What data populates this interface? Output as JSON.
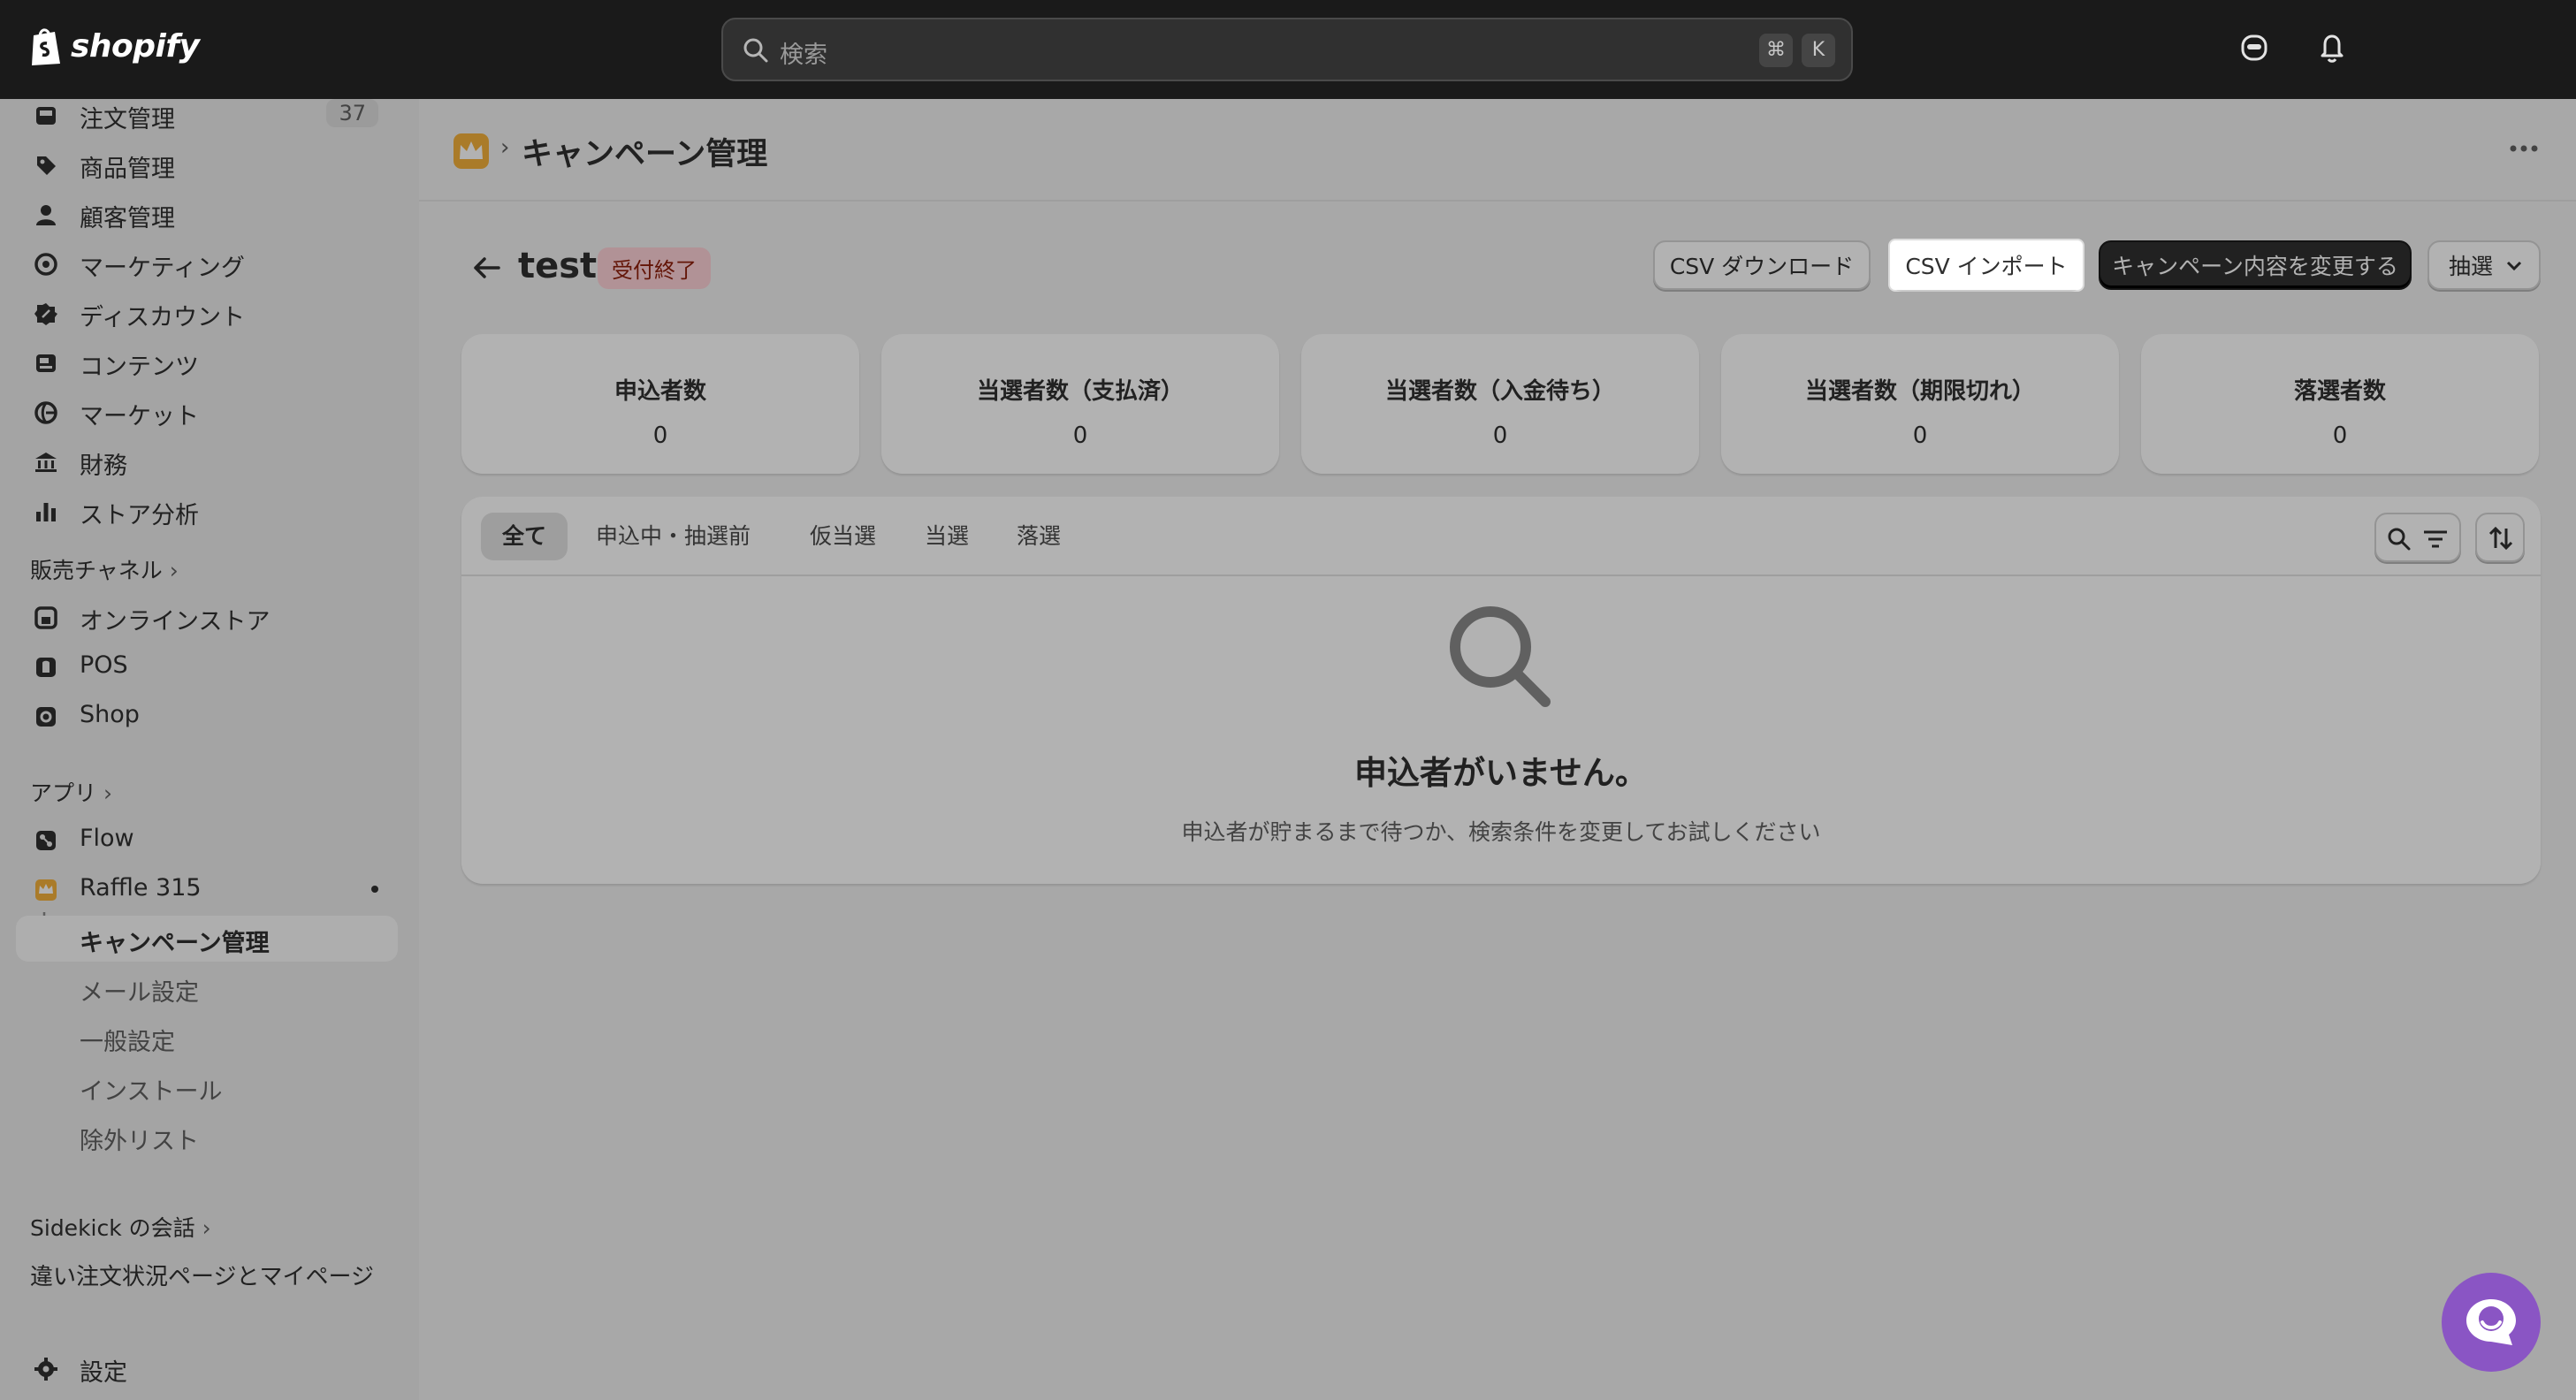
{
  "topbar": {
    "logo_text": "shopify",
    "search_placeholder": "検索",
    "kbd_cmd": "⌘",
    "kbd_key": "K"
  },
  "sidebar": {
    "items": [
      {
        "label": "注文管理",
        "count": "37"
      },
      {
        "label": "商品管理"
      },
      {
        "label": "顧客管理"
      },
      {
        "label": "マーケティング"
      },
      {
        "label": "ディスカウント"
      },
      {
        "label": "コンテンツ"
      },
      {
        "label": "マーケット"
      },
      {
        "label": "財務"
      },
      {
        "label": "ストア分析"
      }
    ],
    "sales_channels_heading": "販売チャネル",
    "channels": [
      {
        "label": "オンラインストア"
      },
      {
        "label": "POS"
      },
      {
        "label": "Shop"
      }
    ],
    "apps_heading": "アプリ",
    "apps": [
      {
        "label": "Flow"
      },
      {
        "label": "Raffle 315"
      }
    ],
    "app_subitems": [
      {
        "label": "キャンペーン管理"
      },
      {
        "label": "メール設定"
      },
      {
        "label": "一般設定"
      },
      {
        "label": "インストール"
      },
      {
        "label": "除外リスト"
      }
    ],
    "sidekick_heading": "Sidekick の会話",
    "sidekick_item": "違い注文状況ページとマイページ",
    "settings_label": "設定"
  },
  "page": {
    "breadcrumb_title": "キャンペーン管理",
    "title": "test",
    "status_badge": "受付終了",
    "buttons": {
      "csv_download": "CSV ダウンロード",
      "csv_import": "CSV インポート",
      "edit_campaign": "キャンペーン内容を変更する",
      "draw": "抽選"
    },
    "stats": [
      {
        "label": "申込者数",
        "value": "0"
      },
      {
        "label": "当選者数（支払済）",
        "value": "0"
      },
      {
        "label": "当選者数（入金待ち）",
        "value": "0"
      },
      {
        "label": "当選者数（期限切れ）",
        "value": "0"
      },
      {
        "label": "落選者数",
        "value": "0"
      }
    ],
    "tabs": [
      {
        "label": "全て"
      },
      {
        "label": "申込中・抽選前"
      },
      {
        "label": "仮当選"
      },
      {
        "label": "当選"
      },
      {
        "label": "落選"
      }
    ],
    "empty_title": "申込者がいません。",
    "empty_subtitle": "申込者が貯まるまで待つか、検索条件を変更してお試しください"
  },
  "colors": {
    "topbar": "#1a1a1a",
    "badge_bg": "#fed1d7",
    "badge_text": "#8e1f0b",
    "primary_button": "#303030",
    "chat_button": "#8a55c4"
  }
}
